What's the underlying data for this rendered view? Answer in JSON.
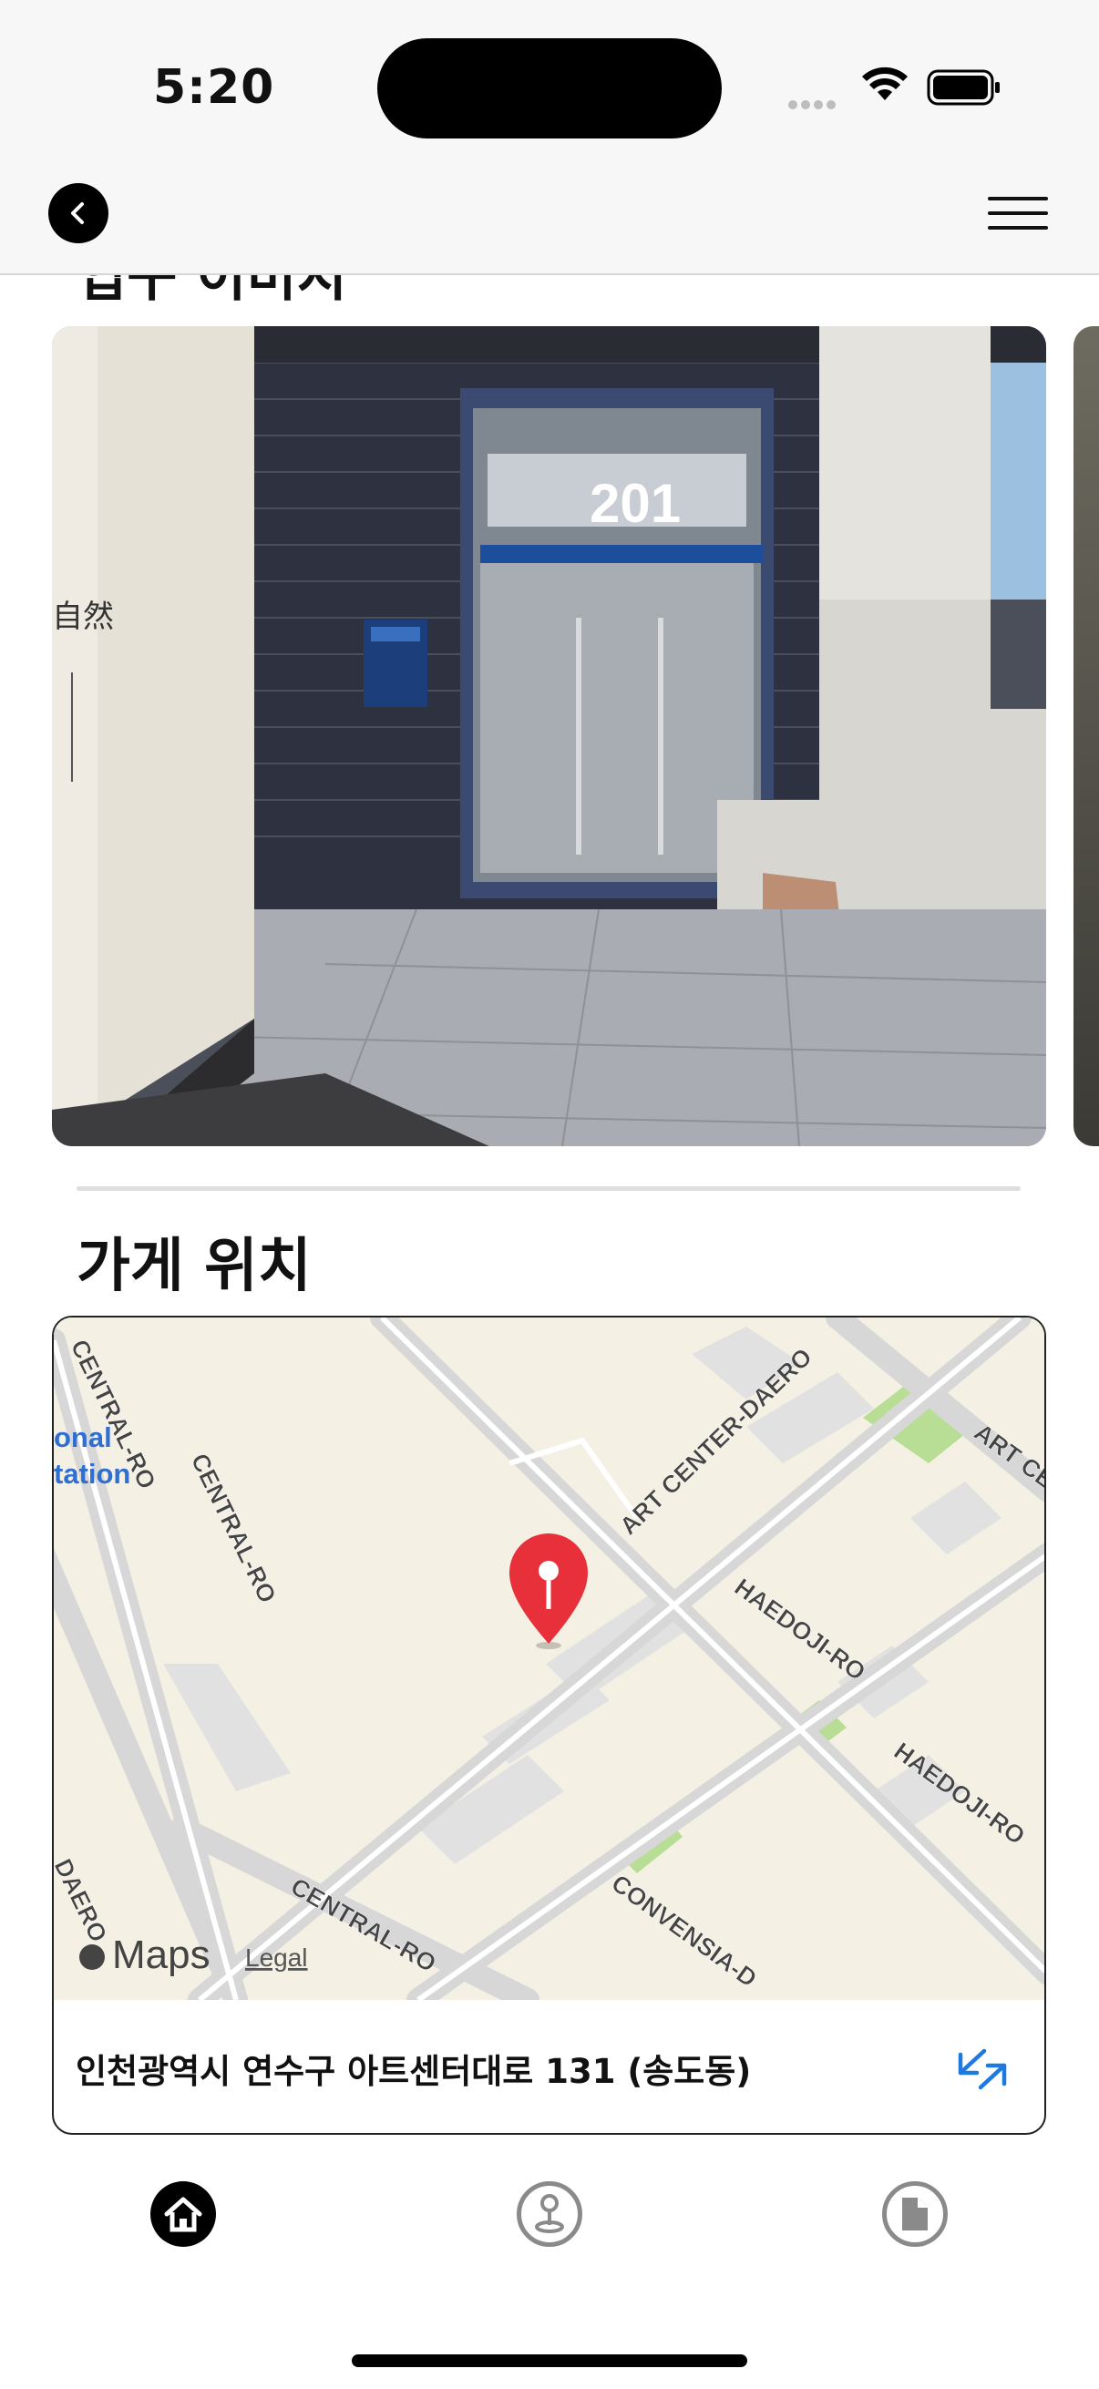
{
  "status_bar": {
    "time": "5:20"
  },
  "header": {
    "back_icon": "chevron-left-icon",
    "menu_icon": "hamburger-menu-icon"
  },
  "gallery": {
    "title": "입구 이미지",
    "photo_sign_text": "201",
    "photo_wall_text": "自然"
  },
  "location": {
    "title": "가게 위치",
    "address": "인천광역시 연수구 아트센터대로 131 (송도동)",
    "expand_icon": "expand-arrows-icon",
    "map": {
      "labels": {
        "road1": "CENTRAL-RO",
        "road2": "CENTRAL-RO",
        "road3": "CENTRAL-RO",
        "road4": "ART CENTER-DAERO",
        "road5": "ART CE",
        "road6": "HAEDOJI-RO",
        "road7": "HAEDOJI-RO",
        "road8": "CONVENSIA-D",
        "road9": "DAERO",
        "poi1": "onal",
        "poi2": "tation"
      },
      "attribution": "Maps",
      "legal": "Legal",
      "pin_color": "#e8303a"
    }
  },
  "tab_bar": {
    "tabs": [
      {
        "name": "home",
        "icon": "home-icon",
        "active": true
      },
      {
        "name": "location",
        "icon": "map-pin-icon",
        "active": false
      },
      {
        "name": "document",
        "icon": "document-icon",
        "active": false
      }
    ]
  },
  "colors": {
    "accent": "#1f7ae0",
    "map_road": "#d7d7d7",
    "map_park": "#b8dd94"
  }
}
